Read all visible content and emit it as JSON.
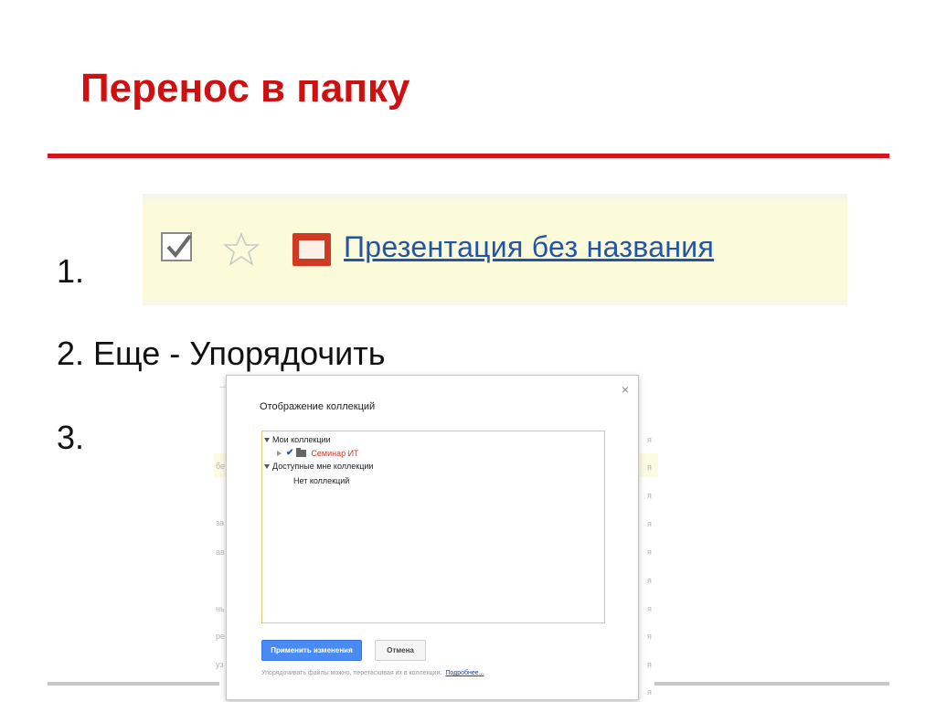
{
  "slide": {
    "title": "Перенос в папку",
    "steps": [
      "1.",
      "2. Еще - Упорядочить",
      "3."
    ]
  },
  "file_row": {
    "file_name": "Презентация без названия",
    "checked": true,
    "starred": false,
    "icon": "presentation-icon"
  },
  "background_list": {
    "left_chars": [
      "бе",
      "за",
      "ав",
      "нь",
      "ре",
      "уз"
    ],
    "right_char": "я"
  },
  "dialog": {
    "title": "Отображение коллекций",
    "close_label": "×",
    "tree": {
      "my_collections_label": "Мои коллекции",
      "collection_name": "Семинар ИТ",
      "collection_checked": true,
      "shared_collections_label": "Доступные мне коллекции",
      "no_collections_label": "Нет коллекций"
    },
    "apply_label": "Применить изменения",
    "cancel_label": "Отмена",
    "hint": "Упорядочивать файлы можно, перетаскивая их в коллекции.",
    "hint_link": "Подробнее..."
  },
  "colors": {
    "title_red": "#d01010",
    "rule_red": "#d7141a",
    "highlight_yellow": "#fbfbda",
    "link_blue": "#2255aa",
    "apply_blue": "#4a8af4"
  }
}
